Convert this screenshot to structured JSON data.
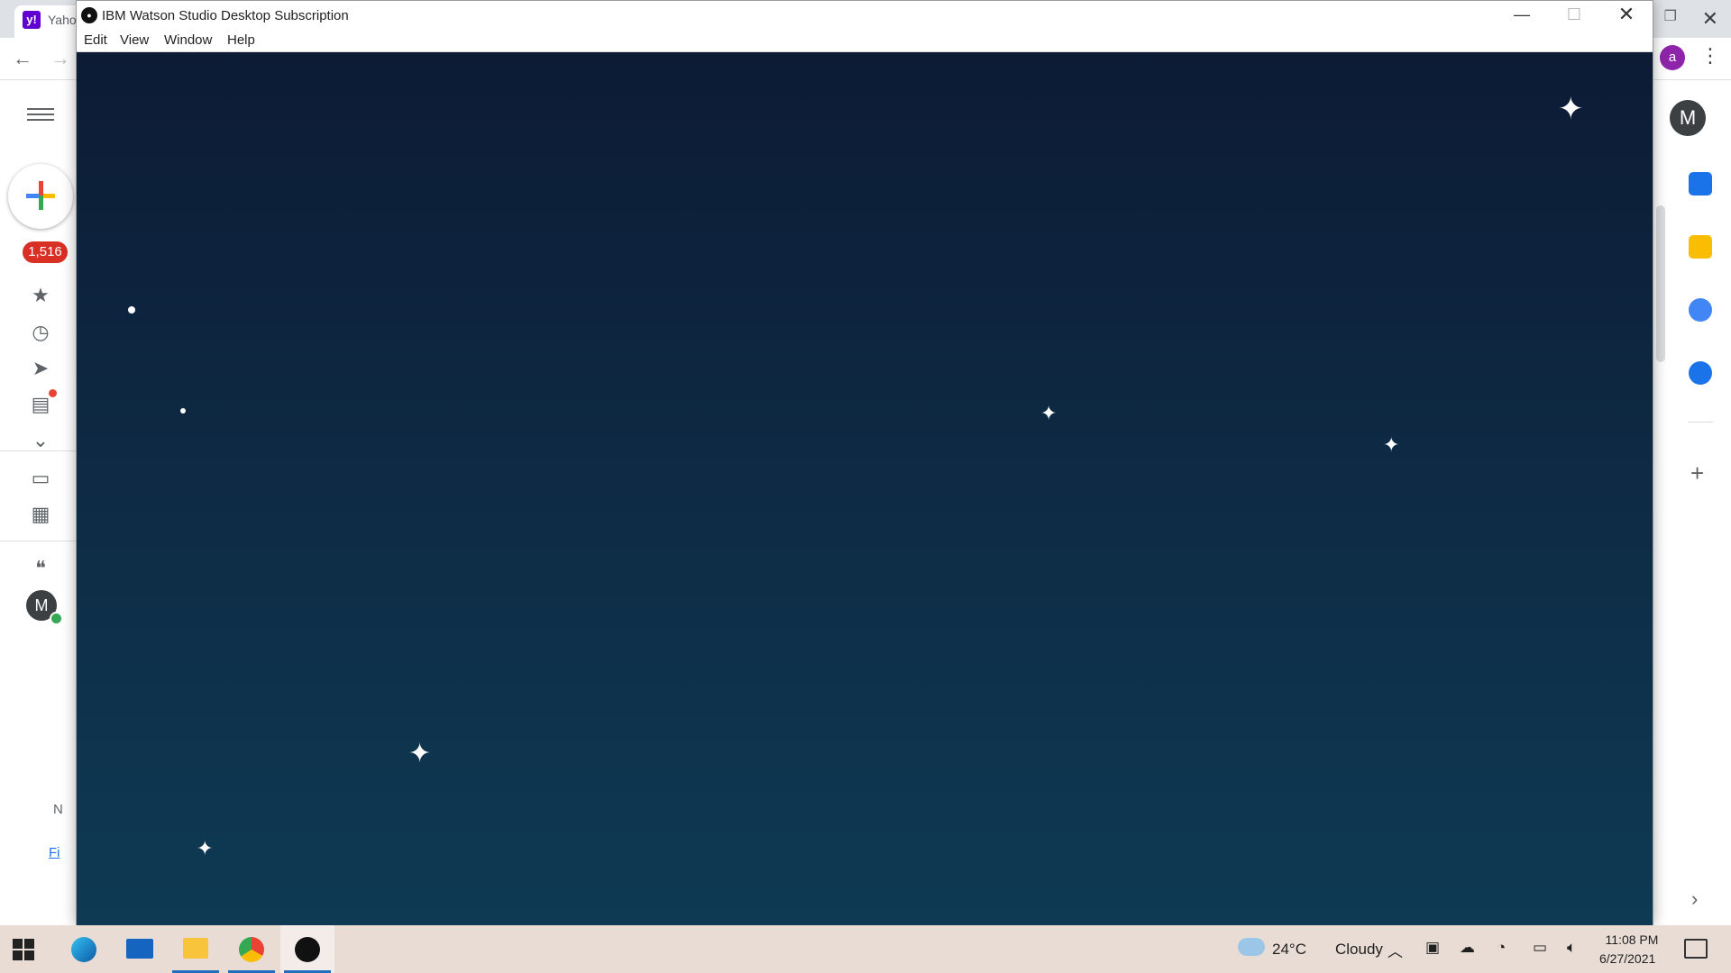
{
  "browser": {
    "tab_title": "Yaho",
    "tab_favicon_text": "y!",
    "profile_initial": "a"
  },
  "gmail": {
    "inbox_count": "1,516",
    "user_initial": "M",
    "footer_text": "N",
    "footer_link": "Fi"
  },
  "app": {
    "title": "IBM Watson Studio Desktop Subscription",
    "menu": [
      "Edit",
      "View",
      "Window",
      "Help"
    ],
    "canvas_gradient": [
      "#0d1b35",
      "#0e3a54"
    ]
  },
  "taskbar": {
    "weather_temp": "24°C",
    "weather_text": "Cloudy",
    "time": "11:08 PM",
    "date": "6/27/2021",
    "apps": [
      "edge-icon",
      "mail-icon",
      "file-explorer-icon",
      "chrome-icon",
      "watson-studio-icon"
    ]
  }
}
